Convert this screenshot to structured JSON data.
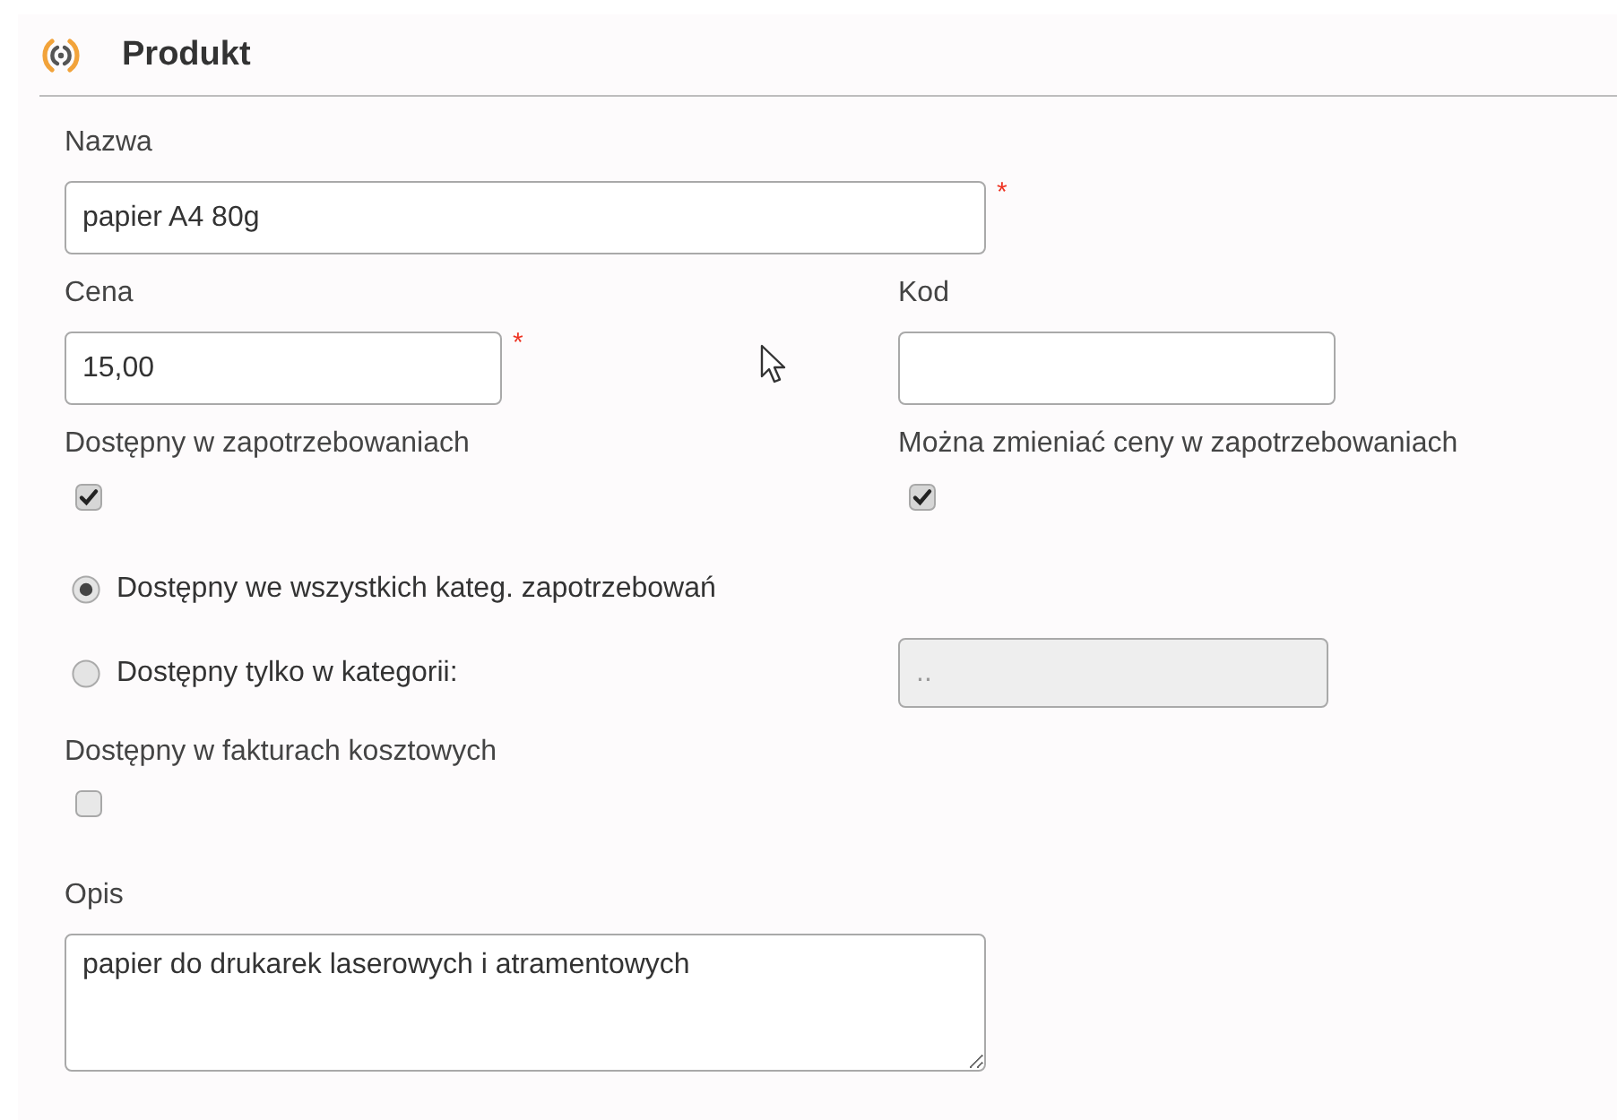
{
  "panel": {
    "title": "Produkt"
  },
  "name_field": {
    "label": "Nazwa",
    "value": "papier A4 80g",
    "required_mark": "*"
  },
  "price_field": {
    "label": "Cena",
    "value": "15,00",
    "required_mark": "*"
  },
  "code_field": {
    "label": "Kod"
  },
  "checkboxes_top": [
    {
      "label": "Dostępny w zapotrzebowaniach",
      "checked": true
    },
    {
      "label": "Można zmieniać ceny w zapotrzebowaniach",
      "checked": true
    }
  ],
  "scope_options": [
    {
      "label": "Dostępny we wszystkich kateg. zapotrzebowań",
      "selected": true
    },
    {
      "label": "Dostępny tylko w kategorii:",
      "selected": false
    }
  ],
  "category_select": {
    "value": "..",
    "disabled": true
  },
  "invoice_checkbox": {
    "label": "Dostępny w fakturach kosztowych",
    "checked": false
  },
  "description": {
    "label": "Opis",
    "value": "papier do drukarek laserowych i atramentowych"
  }
}
